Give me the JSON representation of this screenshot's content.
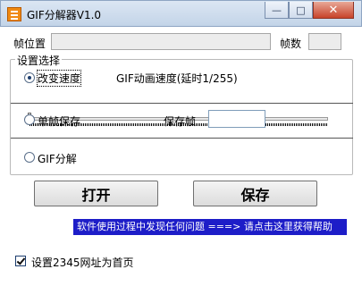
{
  "window": {
    "title": "GIF分解器V1.0",
    "buttons": {
      "minimize": "—",
      "maximize": "□",
      "close": "✕"
    }
  },
  "frame_position": {
    "label": "帧位置",
    "value": ""
  },
  "frame_count": {
    "label": "帧数",
    "value": ""
  },
  "settings": {
    "group_label": "设置选择",
    "change_speed": {
      "label": "改变速度",
      "checked": true
    },
    "speed_info": "GIF动画速度(延时1/255)",
    "speed_slider": {
      "value_fraction": 0.0
    },
    "single_frame_save": {
      "label": "单帧保存",
      "checked": false
    },
    "save_frame": {
      "label": "保存帧",
      "value": ""
    },
    "gif_decompose": {
      "label": "GIF分解",
      "checked": false
    }
  },
  "actions": {
    "open_label": "打开",
    "save_label": "保存"
  },
  "help_banner": "软件使用过程中发现任何问题 ===> 请点击这里获得帮助",
  "homepage_option": {
    "label": "设置2345网址为首页",
    "checked": true
  },
  "colors": {
    "banner_bg": "#1d1dc8",
    "banner_text": "#ffffff",
    "icon_accent": "#f08a12"
  }
}
